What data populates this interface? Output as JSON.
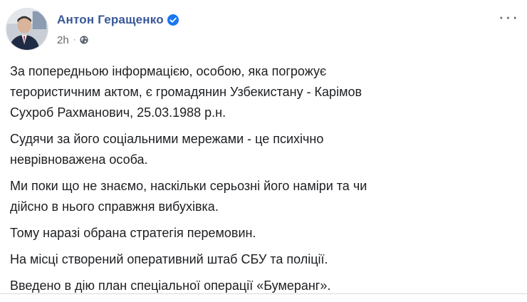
{
  "author": {
    "name": "Антон Геращенко",
    "verified": true,
    "avatar_icon": "profile-photo"
  },
  "meta": {
    "timestamp": "2h",
    "separator": "·",
    "audience_icon": "globe-icon"
  },
  "menu": {
    "more_label": "···"
  },
  "colors": {
    "author_link": "#385898",
    "verified_badge": "#1877f2",
    "meta_text": "#606770",
    "body_text": "#1c1e21"
  },
  "post": {
    "paragraphs": [
      "За попередньою інформацією, особою, яка погрожує терористичним актом, є громадянин Узбекистану - Карімов Сухроб Рахманович, 25.03.1988 р.н.",
      "Судячи за його соціальними мережами - це психічно неврівноважена особа.",
      "Ми поки що не знаємо, наскільки серьозні його наміри та чи дійсно в нього справжня вибухівка.",
      "Тому наразі обрана стратегія перемовин.",
      "На місці створений оперативний штаб СБУ та поліції.",
      "Введено в дію план спеціальної операції «Бумеранг»."
    ]
  }
}
